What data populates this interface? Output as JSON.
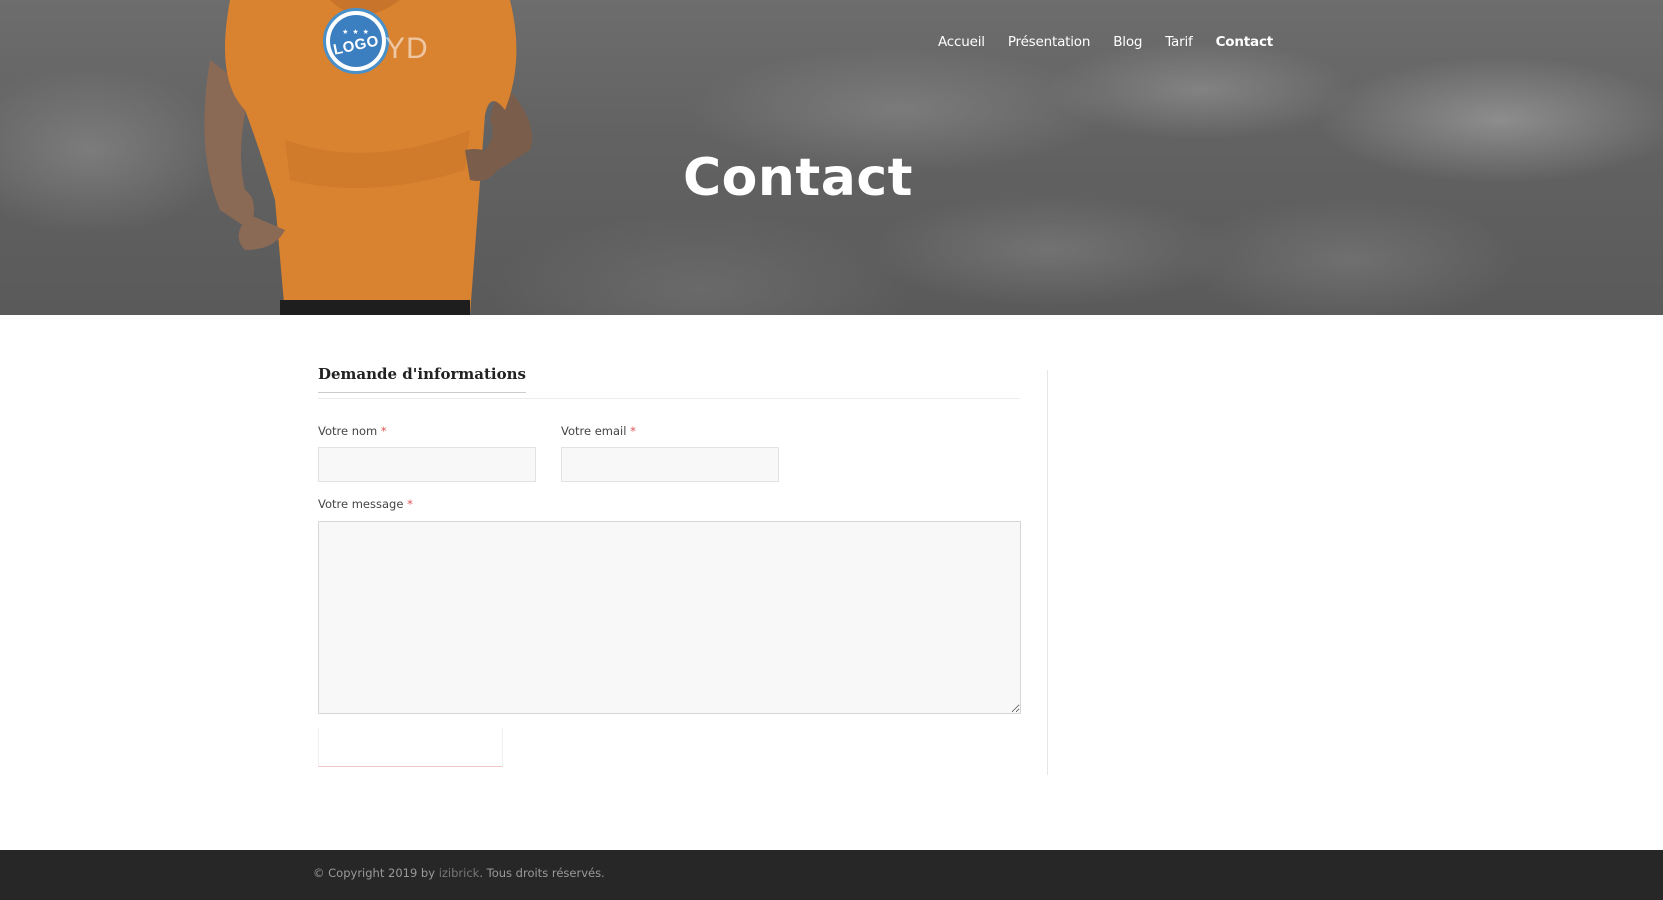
{
  "header": {
    "logo_text": "LOGO",
    "logo_stars": "★ ★ ★",
    "brand_fragment": "YD"
  },
  "nav": {
    "items": [
      "Accueil",
      "Présentation",
      "Blog",
      "Tarif",
      "Contact"
    ],
    "active": "Contact"
  },
  "hero": {
    "title": "Contact"
  },
  "form": {
    "title": "Demande d'informations",
    "name_label": "Votre nom",
    "email_label": "Votre email",
    "message_label": "Votre message",
    "required_mark": "*",
    "name_value": "",
    "email_value": "",
    "message_value": "",
    "submit_label": ""
  },
  "footer": {
    "prefix": "© Copyright 2019 by ",
    "link": "izibrick",
    "suffix": ". Tous droits réservés."
  },
  "colors": {
    "required": "#e05252",
    "footer_bg": "#272727",
    "shirt": "#e08a35",
    "logo_blue": "#3b7fc0"
  }
}
